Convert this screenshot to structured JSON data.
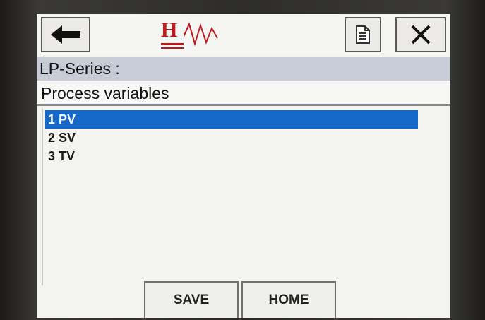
{
  "toolbar": {
    "back_icon": "arrow-left-icon",
    "logo_letter": "H",
    "doc_icon": "document-icon",
    "close_icon": "close-icon",
    "logo_color": "#c01818"
  },
  "header": {
    "title": "LP-Series  :",
    "subtitle": "Process variables",
    "title_bg": "#c7ccd6"
  },
  "menu": {
    "items": [
      {
        "label": "1 PV",
        "selected": true
      },
      {
        "label": "2 SV",
        "selected": false
      },
      {
        "label": "3 TV",
        "selected": false
      }
    ],
    "selection_color": "#1668c6"
  },
  "footer": {
    "save_label": "SAVE",
    "home_label": "HOME"
  }
}
